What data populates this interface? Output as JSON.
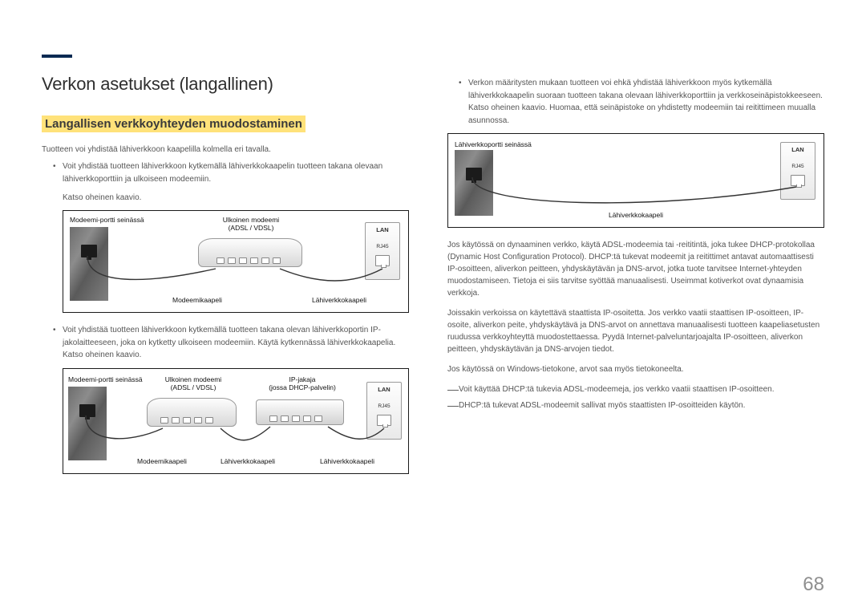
{
  "page": {
    "number": "68"
  },
  "left": {
    "title": "Verkon asetukset (langallinen)",
    "subtitle": "Langallisen verkkoyhteyden muodostaminen",
    "intro": "Tuotteen voi yhdistää lähiverkkoon kaapelilla kolmella eri tavalla.",
    "bullet1": "Voit yhdistää tuotteen lähiverkkoon kytkemällä lähiverkkokaapelin tuotteen takana olevaan lähiverkkoporttiin ja ulkoiseen modeemiin.",
    "see1": "Katso oheinen kaavio.",
    "diagram1": {
      "wall_label": "Modeemi-portti seinässä",
      "modem_label_line1": "Ulkoinen modeemi",
      "modem_label_line2": "(ADSL / VDSL)",
      "panel_lan": "LAN",
      "panel_rj": "RJ45",
      "bottom_modem_cable": "Modeemikaapeli",
      "bottom_lan_cable": "Lähiverkkokaapeli"
    },
    "bullet2": "Voit yhdistää tuotteen lähiverkkoon kytkemällä tuotteen takana olevan lähiverkkoportin IP-jakolaitteeseen, joka on kytketty ulkoiseen modeemiin. Käytä kytkennässä lähiverkkokaapelia. Katso oheinen kaavio.",
    "diagram2": {
      "wall_label": "Modeemi-portti seinässä",
      "modem_label_line1": "Ulkoinen modeemi",
      "modem_label_line2": "(ADSL / VDSL)",
      "router_label_line1": "IP-jakaja",
      "router_label_line2": "(jossa DHCP-palvelin)",
      "panel_lan": "LAN",
      "panel_rj": "RJ45",
      "bottom_modem_cable": "Modeemikaapeli",
      "bottom_lan_cable1": "Lähiverkkokaapeli",
      "bottom_lan_cable2": "Lähiverkkokaapeli"
    }
  },
  "right": {
    "bullet1": "Verkon määritysten mukaan tuotteen voi ehkä yhdistää lähiverkkoon myös kytkemällä lähiverkkokaapelin suoraan tuotteen takana olevaan lähiverkkoporttiin ja verkkoseinäpistokkeeseen. Katso oheinen kaavio. Huomaa, että seinäpistoke on yhdistetty modeemiin tai reitittimeen muualla asunnossa.",
    "diagram3": {
      "wall_label": "Lähiverkkoportti seinässä",
      "panel_lan": "LAN",
      "panel_rj": "RJ45",
      "bottom_lan_cable": "Lähiverkkokaapeli"
    },
    "para1": "Jos käytössä on dynaaminen verkko, käytä ADSL-modeemia tai -reititintä, joka tukee DHCP-protokollaa (Dynamic Host Configuration Protocol). DHCP:tä tukevat modeemit ja reitittimet antavat automaattisesti IP-osoitteen, aliverkon peitteen, yhdyskäytävän ja DNS-arvot, jotka tuote tarvitsee Internet-yhteyden muodostamiseen. Tietoja ei siis tarvitse syöttää manuaalisesti. Useimmat kotiverkot ovat dynaamisia verkkoja.",
    "para2": "Joissakin verkoissa on käytettävä staattista IP-osoitetta. Jos verkko vaatii staattisen IP-osoitteen, IP-osoite, aliverkon peite, yhdyskäytävä ja DNS-arvot on annettava manuaalisesti tuotteen kaapeliasetusten ruudussa verkkoyhteyttä muodostettaessa. Pyydä Internet-palveluntarjoajalta IP-osoitteen, aliverkon peitteen, yhdyskäytävän ja DNS-arvojen tiedot.",
    "para3": "Jos käytössä on Windows-tietokone, arvot saa myös tietokoneelta.",
    "note1": "Voit käyttää DHCP:tä tukevia ADSL-modeemeja, jos verkko vaatii staattisen IP-osoitteen.",
    "note2": "DHCP:tä tukevat ADSL-modeemit sallivat myös staattisten IP-osoitteiden käytön."
  }
}
